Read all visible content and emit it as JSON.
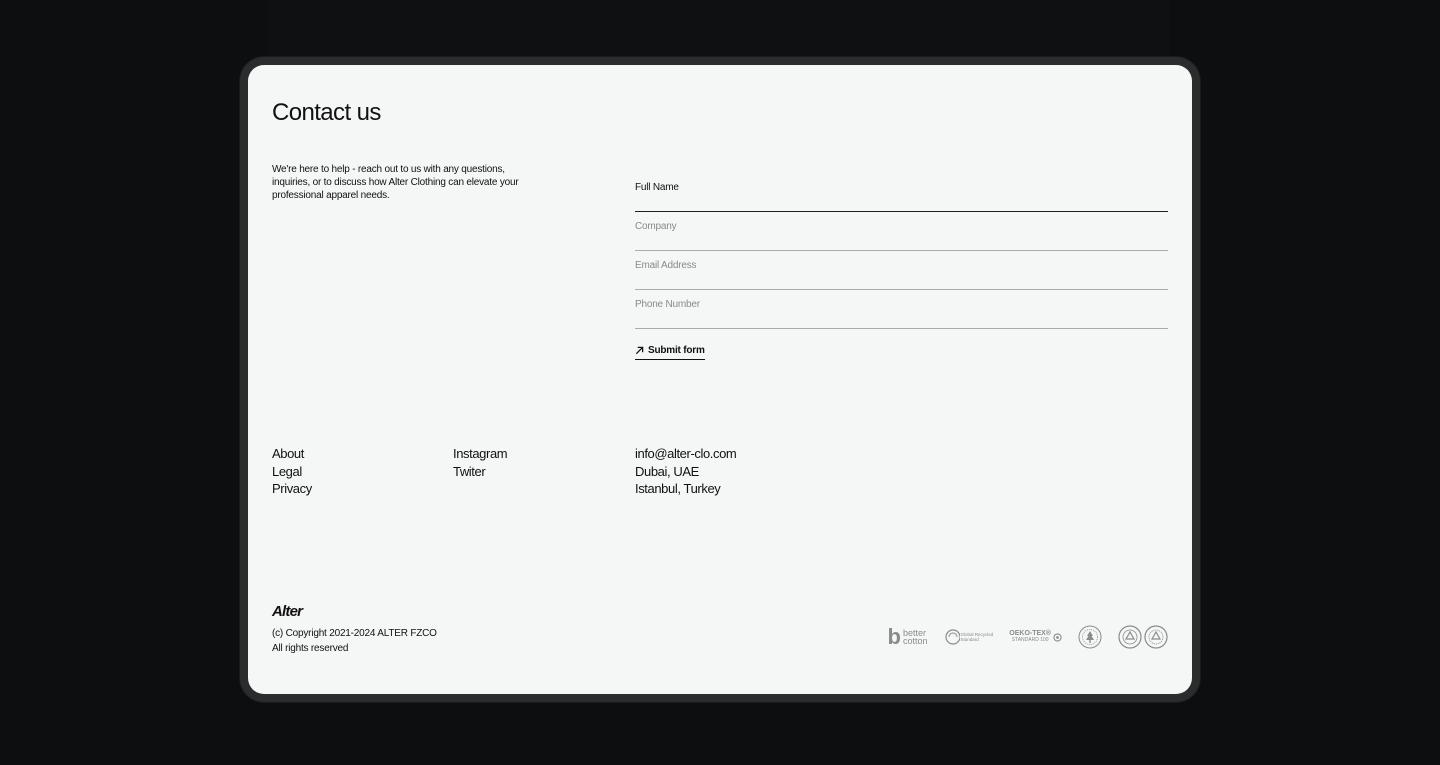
{
  "contact": {
    "title": "Contact us",
    "intro": "We're here to help - reach out to us with any questions, inquiries, or to discuss how Alter Clothing can elevate your professional apparel needs."
  },
  "form": {
    "full_name_placeholder": "Full Name",
    "company_placeholder": "Company",
    "email_placeholder": "Email Address",
    "phone_placeholder": "Phone Number",
    "submit_label": "Submit form"
  },
  "footer": {
    "nav": [
      "About",
      "Legal",
      "Privacy"
    ],
    "social": [
      "Instagram",
      "Twiter"
    ],
    "contact": [
      "info@alter-clo.com",
      "Dubai, UAE",
      "Istanbul, Turkey"
    ],
    "brand": "Alter",
    "copyright_line1": "(c) Copyright 2021-2024 ALTER FZCO",
    "copyright_line2": "All rights reserved",
    "certifications": {
      "better_cotton_b": "b",
      "better_cotton_line1": "better",
      "better_cotton_line2": "cotton",
      "grs_line1": "Global Recycled",
      "grs_line2": "Standard",
      "oeko_line1": "OEKO-TEX®",
      "oeko_line2": "STANDARD 100"
    }
  },
  "colors": {
    "background": "#0d0e10",
    "card": "#f5f7f6",
    "text": "#111111",
    "muted": "#888a89"
  }
}
